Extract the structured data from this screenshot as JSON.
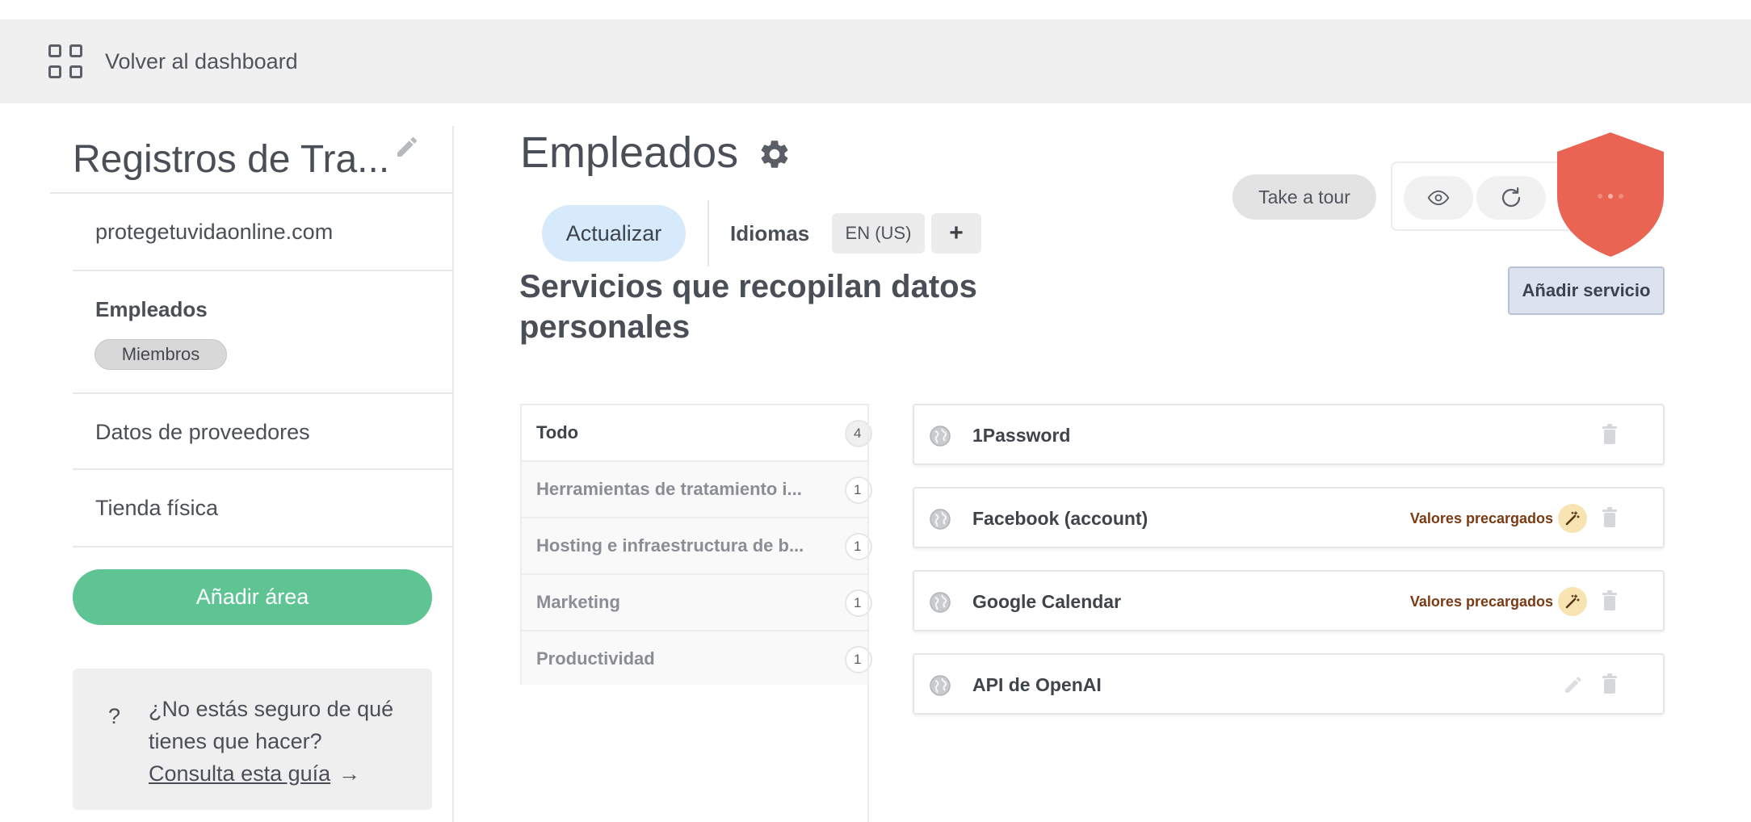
{
  "topbar": {
    "back_label": "Volver al dashboard",
    "back_icon": "grid-icon"
  },
  "sidebar": {
    "title": "Registros de Tra...",
    "edit_icon": "pencil-icon",
    "items": [
      {
        "label": "protegetuvidaonline.com"
      },
      {
        "label": "Empleados",
        "badge": "Miembros"
      },
      {
        "label": "Datos de proveedores"
      },
      {
        "label": "Tienda física"
      }
    ],
    "add_area_label": "Añadir área",
    "help": {
      "question_mark": "?",
      "text": "¿No estás seguro de qué tienes que hacer?",
      "link": "Consulta esta guía",
      "arrow": "→"
    }
  },
  "main": {
    "title": "Empleados",
    "settings_icon": "gear-icon",
    "actualizar_label": "Actualizar",
    "idiomas_label": "Idiomas",
    "language": "EN (US)",
    "add_language": "+",
    "section_heading": "Servicios que recopilan datos personales",
    "tour_label": "Take a tour",
    "add_service_label": "Añadir servicio",
    "categories": [
      {
        "name": "Todo",
        "count": "4"
      },
      {
        "name": "Herramientas de tratamiento i...",
        "count": "1"
      },
      {
        "name": "Hosting e infraestructura de b...",
        "count": "1"
      },
      {
        "name": "Marketing",
        "count": "1"
      },
      {
        "name": "Productividad",
        "count": "1"
      }
    ],
    "services": [
      {
        "name": "1Password",
        "preloaded": ""
      },
      {
        "name": "Facebook (account)",
        "preloaded": "Valores precargados"
      },
      {
        "name": "Google Calendar",
        "preloaded": "Valores precargados"
      },
      {
        "name": "API de OpenAI",
        "preloaded": ""
      }
    ]
  },
  "colors": {
    "green_button": "#5ec494",
    "update_button": "#d6eafb",
    "shield": "#e96452",
    "preloaded_text": "#7a3b14",
    "wand_bg": "#f8e4b2"
  }
}
